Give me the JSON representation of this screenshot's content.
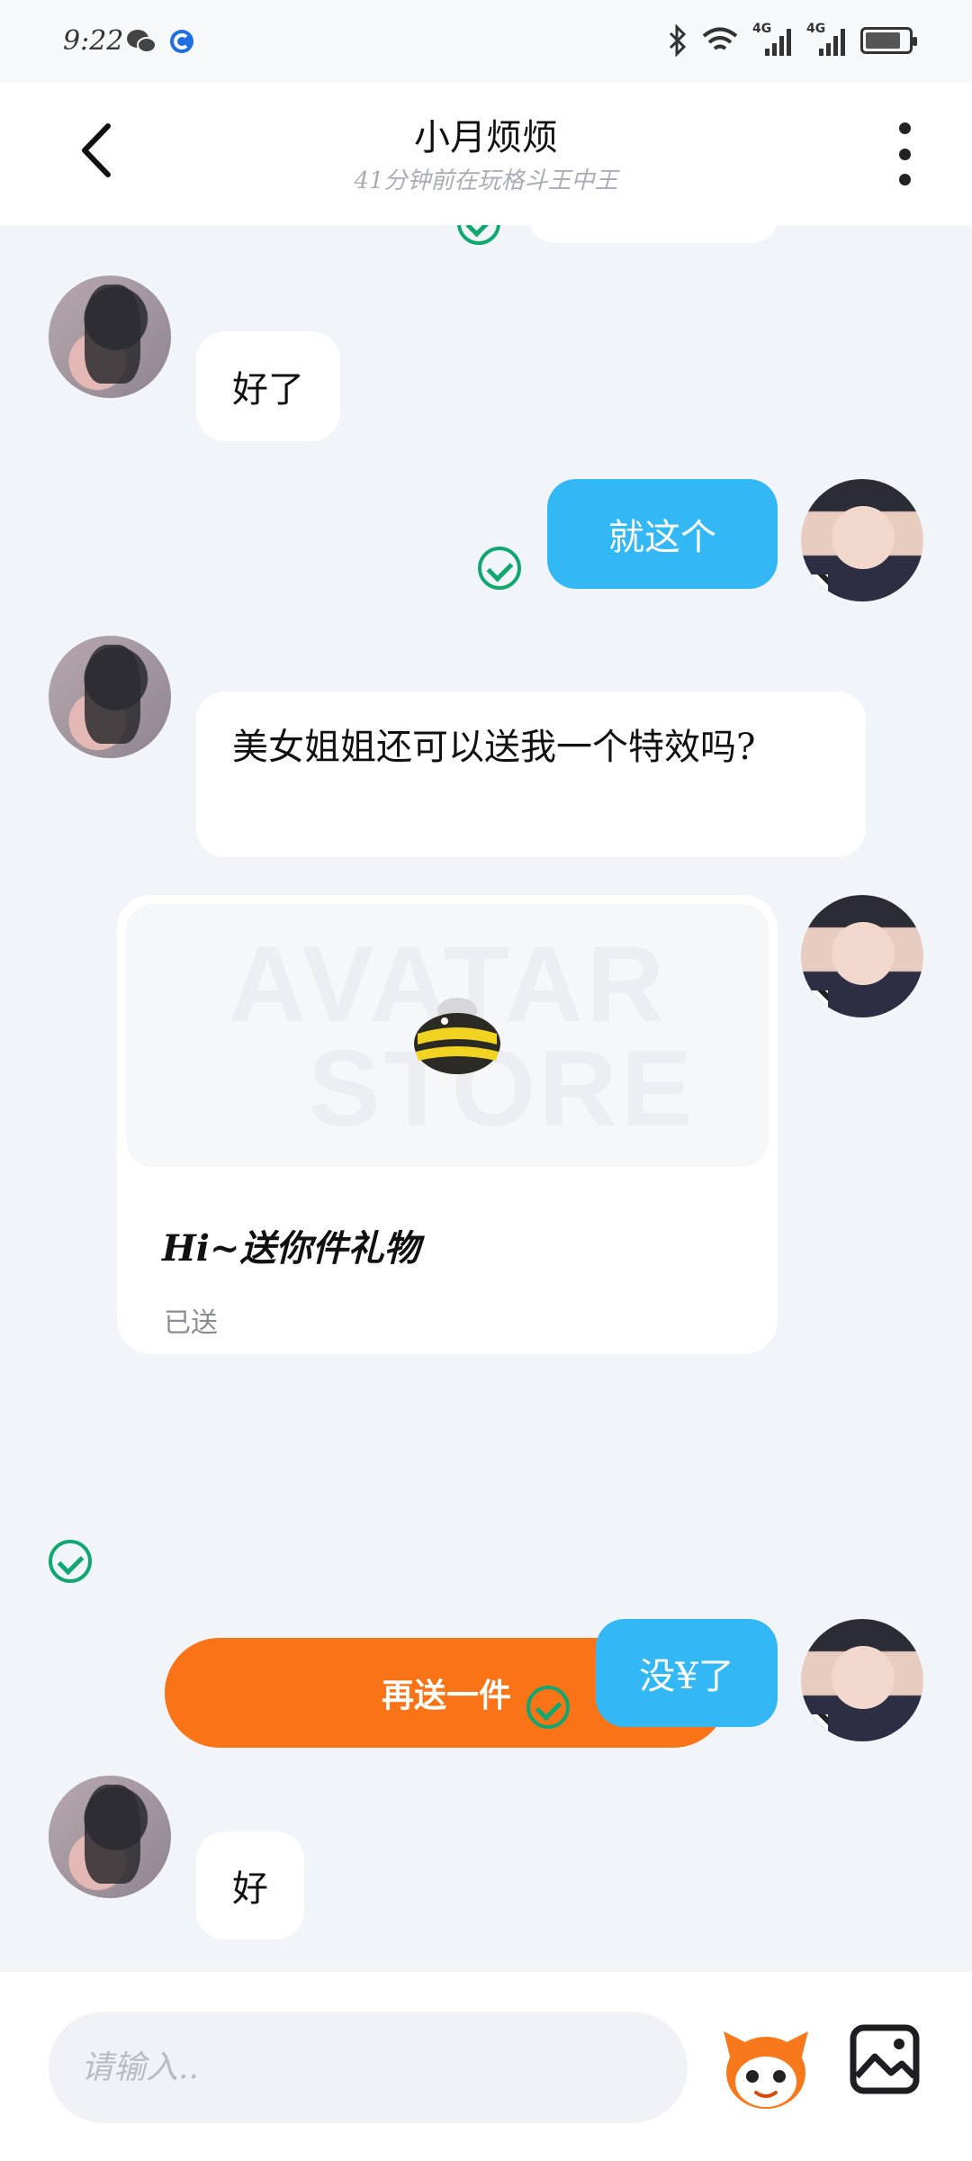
{
  "status_bar": {
    "time": "9:22",
    "left_icons": [
      "wechat-icon",
      "app-notification-icon"
    ],
    "right_icons": [
      "bluetooth-icon",
      "wifi-icon",
      "signal-4g-icon",
      "signal-4g-icon",
      "battery-charging-icon"
    ],
    "network_labels": [
      "4G",
      "4G"
    ]
  },
  "header": {
    "title": "小月烦烦",
    "subtitle": "41分钟前在玩格斗王中王",
    "back_icon": "chevron-left-icon",
    "more_icon": "more-vertical-icon"
  },
  "messages": [
    {
      "from": "them",
      "text": "好了"
    },
    {
      "from": "me",
      "text": "就这个",
      "status": "sent"
    },
    {
      "from": "them",
      "text": "美女姐姐还可以送我一个特效吗?"
    },
    {
      "from": "me",
      "type": "gift",
      "title": "Hi~送你件礼物",
      "status_text": "已送",
      "button": "再送一件",
      "watermark": [
        "AVATAR",
        "STORE"
      ],
      "gift_icon": "bee-gift-icon",
      "status": "sent"
    },
    {
      "from": "me",
      "text": "没¥了",
      "status": "sent"
    },
    {
      "from": "them",
      "text": "好"
    }
  ],
  "input": {
    "placeholder": "请输入..",
    "value": ""
  },
  "toolbar": {
    "mascot_icon": "mascot-face-icon",
    "image_icon": "image-icon"
  },
  "colors": {
    "bubble_me": "#33b8f5",
    "bubble_them": "#ffffff",
    "gift_button": "#fa7316",
    "read_check": "#12a670",
    "background": "#f1f4f9"
  }
}
